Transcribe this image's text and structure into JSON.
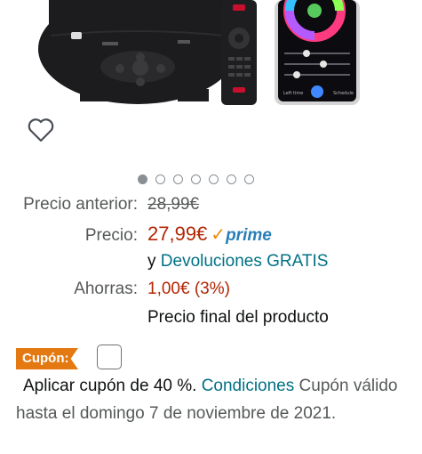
{
  "product": {
    "image_alt": "Proyector de estrellas con mando y app",
    "app_labels": [
      "Left time",
      "Schedule"
    ]
  },
  "carousel": {
    "dot_count": 7,
    "active_index": 0
  },
  "pricing": {
    "previous_label": "Precio anterior:",
    "previous_value": "28,99€",
    "price_label": "Precio:",
    "price_value": "27,99€",
    "prime_label": "prime",
    "returns_prefix": "y",
    "returns_link": "Devoluciones GRATIS",
    "saving_label": "Ahorras:",
    "saving_value": "1,00€ (3%)",
    "final_price_text": "Precio final del producto"
  },
  "coupon": {
    "badge": "Cupón:",
    "apply_text": "Aplicar cupón de 40 %.",
    "conditions_link": "Condiciones",
    "tail": "Cupón",
    "validity": "válido hasta el domingo 7 de noviembre de 2021."
  },
  "colors": {
    "price": "#b12704",
    "link": "#007185",
    "prime": "#2a7fb8",
    "prime_check": "#f08804",
    "coupon_badge": "#e47911"
  }
}
